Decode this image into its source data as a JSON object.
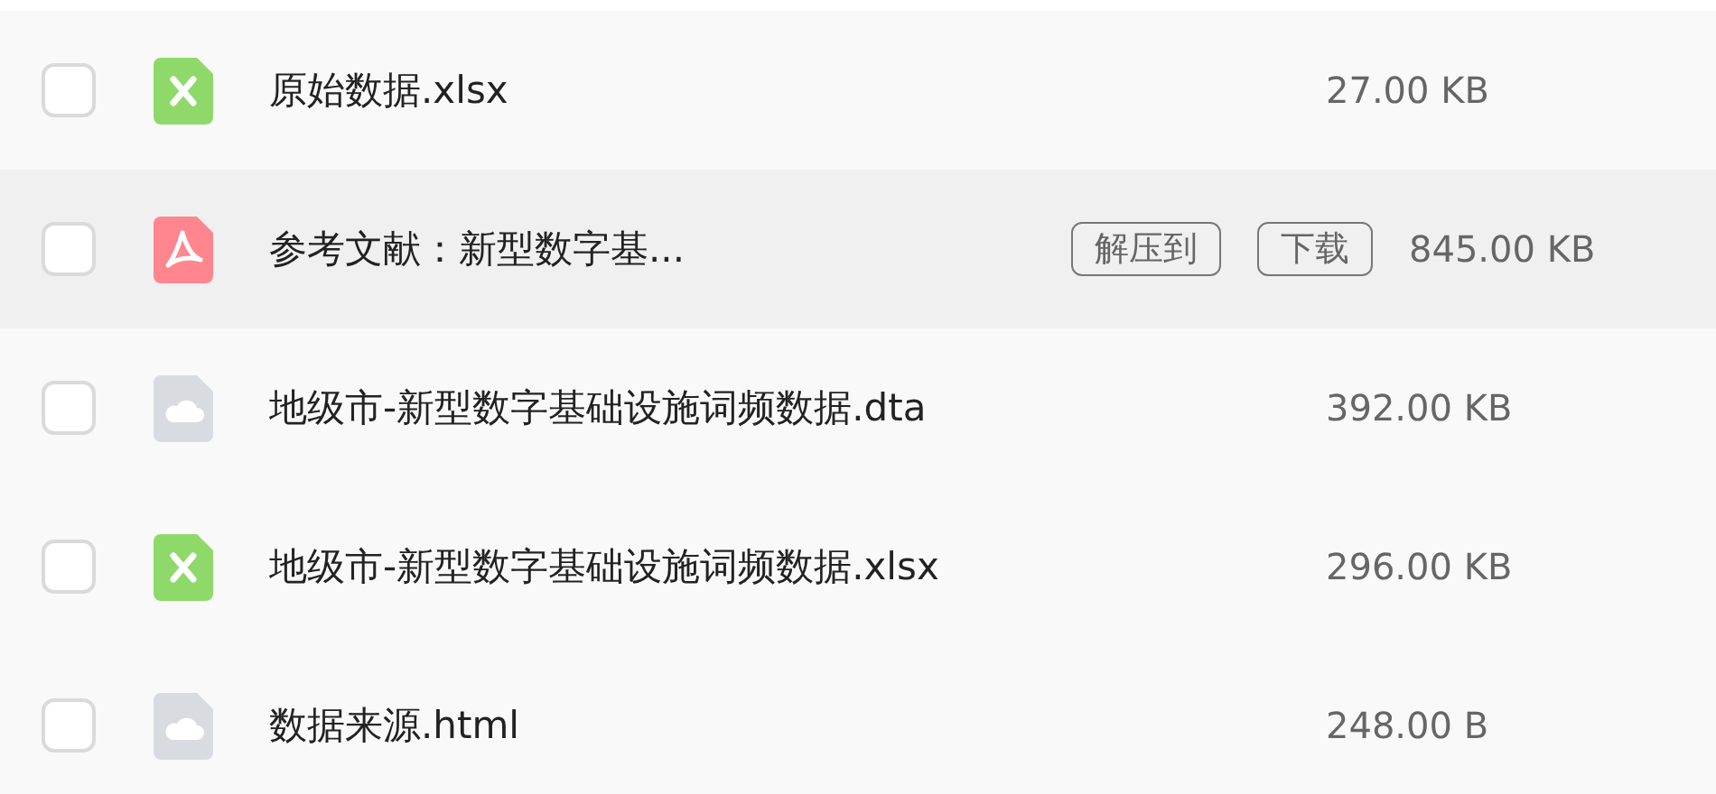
{
  "files": [
    {
      "kind": "excel",
      "name": "原始数据.xlsx",
      "size": "27.00 KB",
      "checked": false,
      "hovered": false
    },
    {
      "kind": "pdf",
      "name": "参考文献：新型数字基...",
      "size": "845.00 KB",
      "checked": false,
      "hovered": true,
      "actions": [
        "解压到",
        "下载"
      ]
    },
    {
      "kind": "file",
      "name": "地级市-新型数字基础设施词频数据.dta",
      "size": "392.00 KB",
      "checked": false,
      "hovered": false
    },
    {
      "kind": "excel",
      "name": "地级市-新型数字基础设施词频数据.xlsx",
      "size": "296.00 KB",
      "checked": false,
      "hovered": false
    },
    {
      "kind": "file",
      "name": "数据来源.html",
      "size": "248.00 B",
      "checked": false,
      "hovered": false
    }
  ]
}
